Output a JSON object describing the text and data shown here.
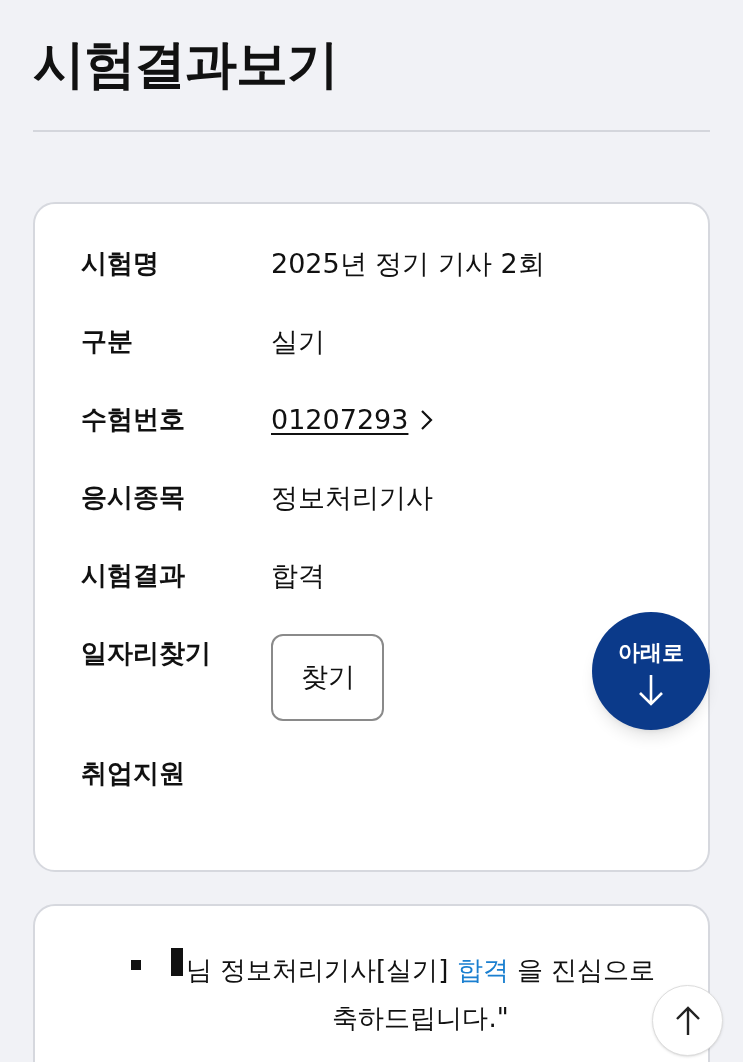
{
  "page_title": "시험결과보기",
  "rows": [
    {
      "label": "시험명",
      "kind": "text",
      "value": "2025년 정기 기사 2회"
    },
    {
      "label": "구분",
      "kind": "text",
      "value": "실기"
    },
    {
      "label": "수험번호",
      "kind": "link",
      "value": "01207293"
    },
    {
      "label": "응시종목",
      "kind": "text",
      "value": "정보처리기사"
    },
    {
      "label": "시험결과",
      "kind": "text",
      "value": "합격"
    },
    {
      "label": "일자리찾기",
      "kind": "button",
      "value": "찾기"
    },
    {
      "label": "취업지원",
      "kind": "empty"
    }
  ],
  "message": {
    "before": "님 정보처리기사[실기] ",
    "highlight": "합격",
    "after": " 을 진심으로 축하드립니다.\""
  },
  "scroll_down_button": {
    "label": "아래로"
  }
}
